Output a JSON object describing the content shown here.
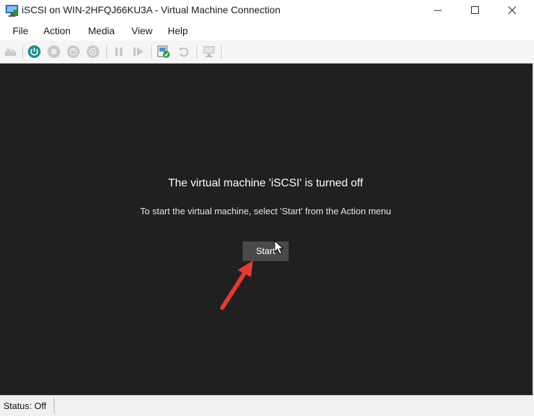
{
  "window": {
    "title": "iSCSI on WIN-2HFQJ66KU3A - Virtual Machine Connection",
    "controls": {
      "minimize_icon": "minimize-icon",
      "maximize_icon": "maximize-icon",
      "close_icon": "close-icon"
    }
  },
  "menu": {
    "file": "File",
    "action": "Action",
    "media": "Media",
    "view": "View",
    "help": "Help"
  },
  "toolbar": {
    "icons": [
      "ctrl-alt-del-icon",
      "start-icon",
      "turn-off-icon",
      "shut-down-icon",
      "save-icon",
      "pause-icon",
      "resume-icon",
      "checkpoint-icon",
      "revert-icon",
      "enhanced-session-icon"
    ],
    "accent": "#1a8f8f"
  },
  "main": {
    "message_title": "The virtual machine 'iSCSI' is turned off",
    "message_subtitle": "To start the virtual machine, select 'Start' from the Action menu",
    "start_label": "Start",
    "background": "#202020",
    "annotation_color": "#e8392f"
  },
  "status": {
    "text": "Status: Off"
  }
}
